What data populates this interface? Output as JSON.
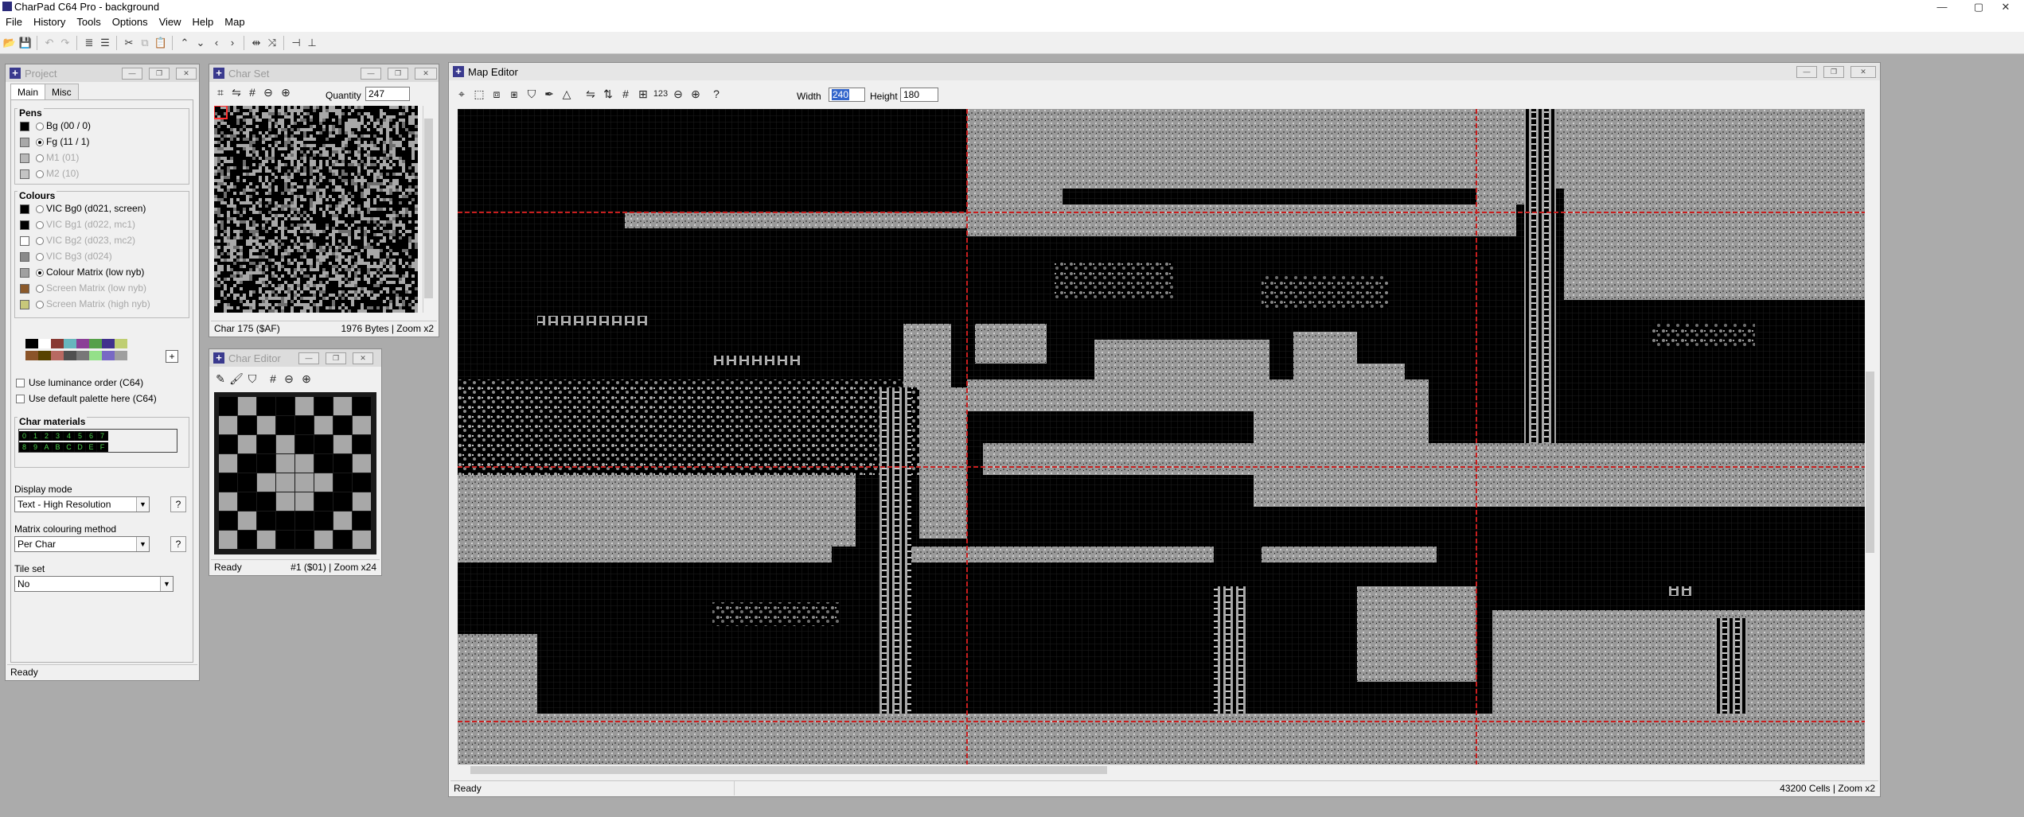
{
  "window": {
    "title": "CharPad C64 Pro - background",
    "min": "—",
    "max": "▢",
    "close": "✕"
  },
  "menu": [
    "File",
    "History",
    "Tools",
    "Options",
    "View",
    "Help",
    "Map"
  ],
  "project": {
    "title": "Project",
    "tabs": [
      "Main",
      "Misc"
    ],
    "pens_heading": "Pens",
    "pens": [
      {
        "label": "Bg (00 / 0)",
        "color": "#000000",
        "checked": false,
        "enabled": true
      },
      {
        "label": "Fg (11 / 1)",
        "color": "#a8a8a8",
        "checked": true,
        "enabled": true
      },
      {
        "label": "M1 (01)",
        "color": "#b8b8b8",
        "checked": false,
        "enabled": false
      },
      {
        "label": "M2 (10)",
        "color": "#c4c4c4",
        "checked": false,
        "enabled": false
      }
    ],
    "colours_heading": "Colours",
    "colours": [
      {
        "label": "VIC Bg0 (d021, screen)",
        "color": "#000000",
        "checked": false,
        "enabled": true
      },
      {
        "label": "VIC Bg1 (d022, mc1)",
        "color": "#000000",
        "checked": false,
        "enabled": false
      },
      {
        "label": "VIC Bg2 (d023, mc2)",
        "color": "#ffffff",
        "checked": false,
        "enabled": false
      },
      {
        "label": "VIC Bg3 (d024)",
        "color": "#8a8a8a",
        "checked": false,
        "enabled": false
      },
      {
        "label": "Colour Matrix (low nyb)",
        "color": "#a0a0a0",
        "checked": true,
        "enabled": true
      },
      {
        "label": "Screen Matrix (low nyb)",
        "color": "#8b5a2b",
        "checked": false,
        "enabled": false
      },
      {
        "label": "Screen Matrix (high nyb)",
        "color": "#c8c87a",
        "checked": false,
        "enabled": false
      }
    ],
    "palette": [
      "#000000",
      "#ffffff",
      "#883932",
      "#67b6bd",
      "#8b3f96",
      "#55a049",
      "#40318d",
      "#bfce72",
      "#8b5429",
      "#574200",
      "#b86962",
      "#505050",
      "#787878",
      "#94e089",
      "#7869c4",
      "#9f9f9f"
    ],
    "checkboxes": [
      "Use luminance order (C64)",
      "Use default palette here (C64)"
    ],
    "char_materials_heading": "Char materials",
    "materials_row1": [
      "0",
      "1",
      "2",
      "3",
      "4",
      "5",
      "6",
      "7"
    ],
    "materials_row2": [
      "8",
      "9",
      "A",
      "B",
      "C",
      "D",
      "E",
      "F"
    ],
    "display_mode_label": "Display mode",
    "display_mode_value": "Text - High Resolution",
    "matrix_label": "Matrix colouring method",
    "matrix_value": "Per Char",
    "tileset_label": "Tile set",
    "tileset_value": "No",
    "help": "?",
    "status": "Ready"
  },
  "charset": {
    "title": "Char Set",
    "quantity_label": "Quantity",
    "quantity_value": "247",
    "status_left": "Char 175 ($AF)",
    "status_right": "1976 Bytes | Zoom x2"
  },
  "chareditor": {
    "title": "Char Editor",
    "status_left": "Ready",
    "status_right": "#1 ($01) | Zoom x24",
    "pattern": [
      [
        0,
        1,
        0,
        0,
        1,
        0,
        1,
        0
      ],
      [
        1,
        0,
        1,
        0,
        0,
        1,
        0,
        1
      ],
      [
        0,
        1,
        0,
        1,
        0,
        0,
        1,
        0
      ],
      [
        1,
        0,
        0,
        1,
        1,
        0,
        0,
        1
      ],
      [
        0,
        0,
        1,
        1,
        1,
        1,
        0,
        0
      ],
      [
        1,
        0,
        0,
        1,
        1,
        0,
        0,
        1
      ],
      [
        0,
        1,
        0,
        0,
        0,
        0,
        1,
        0
      ],
      [
        1,
        0,
        1,
        0,
        0,
        1,
        0,
        1
      ]
    ]
  },
  "mapeditor": {
    "title": "Map Editor",
    "width_label": "Width",
    "width_value": "240",
    "height_label": "Height",
    "height_value": "180",
    "help": "?",
    "status_left": "Ready",
    "status_right": "43200 Cells | Zoom x2"
  }
}
